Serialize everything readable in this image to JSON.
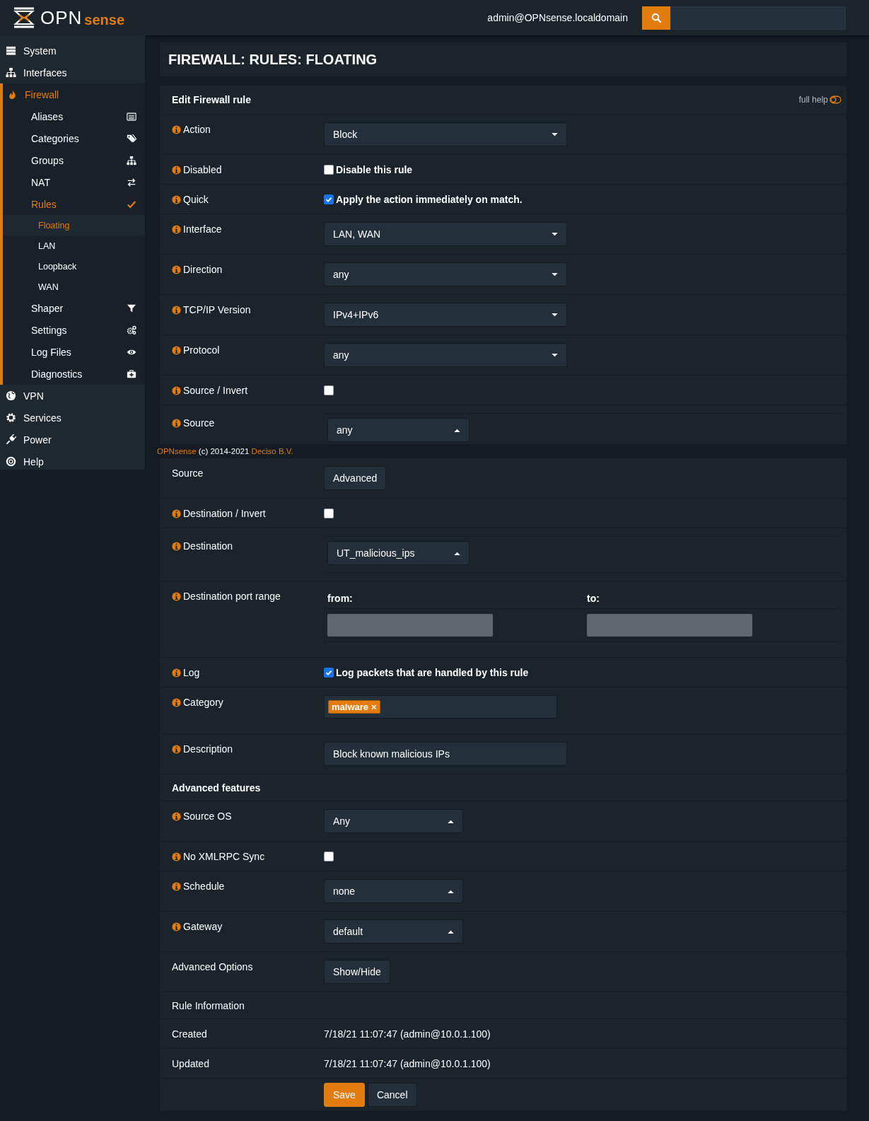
{
  "header": {
    "logo": {
      "part_1": "OPN",
      "part_2": "sense"
    },
    "user": "admin@OPNsense.localdomain"
  },
  "sidebar": {
    "items": [
      {
        "label": "System",
        "selected": false
      },
      {
        "label": "Interfaces",
        "selected": false
      },
      {
        "label": "Firewall",
        "selected": true,
        "expanded": true,
        "children": [
          {
            "label": "Aliases",
            "selected": false
          },
          {
            "label": "Categories",
            "selected": false
          },
          {
            "label": "Groups",
            "selected": false
          },
          {
            "label": "NAT",
            "selected": false
          },
          {
            "label": "Rules",
            "selected": true,
            "expanded": true,
            "children": [
              {
                "label": "Floating",
                "selected": true
              },
              {
                "label": "LAN",
                "selected": false
              },
              {
                "label": "Loopback",
                "selected": false
              },
              {
                "label": "WAN",
                "selected": false
              }
            ]
          },
          {
            "label": "Shaper",
            "selected": false
          },
          {
            "label": "Settings",
            "selected": false
          },
          {
            "label": "Log Files",
            "selected": false
          },
          {
            "label": "Diagnostics",
            "selected": false
          }
        ]
      },
      {
        "label": "VPN",
        "selected": false
      },
      {
        "label": "Services",
        "selected": false
      },
      {
        "label": "Power",
        "selected": false
      },
      {
        "label": "Help",
        "selected": false
      }
    ]
  },
  "page_title": "FIREWALL: RULES: FLOATING",
  "form": {
    "title": "Edit Firewall rule",
    "full_help": {
      "label": "full help",
      "on": false
    },
    "rows": [
      {
        "kind": "select",
        "label": "Action",
        "info": true,
        "value": "Block"
      },
      {
        "kind": "checkbox",
        "label": "Disabled",
        "info": true,
        "checked": false,
        "text": "Disable this rule"
      },
      {
        "kind": "checkbox",
        "label": "Quick",
        "info": true,
        "checked": true,
        "text": "Apply the action immediately on match."
      },
      {
        "kind": "select",
        "label": "Interface",
        "info": true,
        "value": "LAN, WAN"
      },
      {
        "kind": "select",
        "label": "Direction",
        "info": true,
        "value": "any"
      },
      {
        "kind": "select",
        "label": "TCP/IP Version",
        "info": true,
        "value": "IPv4+IPv6"
      },
      {
        "kind": "select",
        "label": "Protocol",
        "info": true,
        "value": "any"
      },
      {
        "kind": "checkbox",
        "label": "Source / Invert",
        "info": true,
        "checked": false
      },
      {
        "kind": "address",
        "label": "Source",
        "info": true,
        "value": "any"
      },
      {
        "kind": "button",
        "label": "Source",
        "info": false,
        "button": "Advanced"
      },
      {
        "kind": "checkbox",
        "label": "Destination / Invert",
        "info": true,
        "checked": false
      },
      {
        "kind": "address",
        "label": "Destination",
        "info": true,
        "value": "UT_malicious_ips"
      },
      {
        "kind": "ports",
        "label": "Destination port range",
        "info": true,
        "from": "from:",
        "to": "to:"
      },
      {
        "kind": "checkbox",
        "label": "Log",
        "info": true,
        "checked": true,
        "text": "Log packets that are handled by this rule"
      },
      {
        "kind": "tags",
        "label": "Category",
        "info": true,
        "tags": [
          {
            "text": "malware",
            "remove": "×"
          }
        ]
      },
      {
        "kind": "text",
        "label": "Description",
        "info": true,
        "value": "Block known malicious IPs"
      },
      {
        "kind": "heading",
        "label": "Advanced features"
      },
      {
        "kind": "dropup",
        "label": "Source OS",
        "info": true,
        "value": "Any"
      },
      {
        "kind": "checkbox",
        "label": "No XMLRPC Sync",
        "info": true,
        "checked": false
      },
      {
        "kind": "dropup",
        "label": "Schedule",
        "info": true,
        "value": "none"
      },
      {
        "kind": "dropup",
        "label": "Gateway",
        "info": true,
        "value": "default"
      },
      {
        "kind": "button",
        "label": "Advanced Options",
        "info": false,
        "button": "Show/Hide"
      },
      {
        "kind": "section",
        "label": "Rule Information"
      },
      {
        "kind": "info",
        "label": "Created",
        "value": "7/18/21 11:07:47 (admin@10.0.1.100)"
      },
      {
        "kind": "info",
        "label": "Updated",
        "value": "7/18/21 11:07:47 (admin@10.0.1.100)"
      },
      {
        "kind": "actions",
        "buttons": [
          {
            "label": "Save",
            "primary": true
          },
          {
            "label": "Cancel",
            "primary": false
          }
        ]
      }
    ]
  },
  "footer": {
    "brand": "OPNsense",
    "copyright": "(c) 2014-2021",
    "company": "Deciso B.V."
  }
}
